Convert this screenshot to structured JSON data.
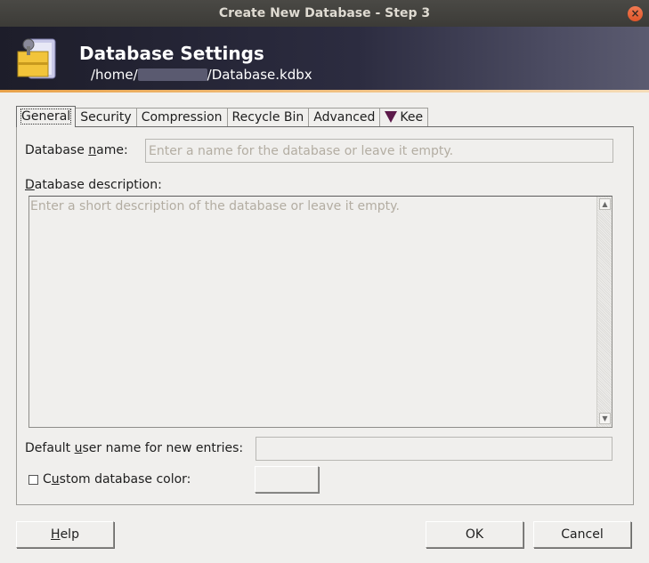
{
  "window": {
    "title": "Create New Database - Step 3",
    "close_glyph": "×"
  },
  "banner": {
    "title": "Database Settings",
    "path_prefix": "/home/",
    "path_suffix": "/Database.kdbx"
  },
  "tabs": [
    {
      "label": "General",
      "active": true
    },
    {
      "label": "Security"
    },
    {
      "label": "Compression"
    },
    {
      "label": "Recycle Bin"
    },
    {
      "label": "Advanced"
    },
    {
      "label": "Kee"
    }
  ],
  "general": {
    "db_name_label_pre": "Database ",
    "db_name_label_u": "n",
    "db_name_label_post": "ame:",
    "db_name_value": "",
    "db_name_placeholder": "Enter a name for the database or leave it empty.",
    "db_desc_label_u": "D",
    "db_desc_label_post": "atabase description:",
    "db_desc_value": "",
    "db_desc_placeholder": "Enter a short description of the database or leave it empty.",
    "scroll_up_glyph": "▲",
    "scroll_down_glyph": "▼",
    "user_label_pre": "Default ",
    "user_label_u": "u",
    "user_label_post": "ser name for new entries:",
    "user_value": "",
    "color_label_pre": "C",
    "color_label_u": "u",
    "color_label_post": "stom database color:",
    "color_checked": false
  },
  "buttons": {
    "help_u": "H",
    "help_post": "elp",
    "ok": "OK",
    "cancel": "Cancel"
  },
  "colors": {
    "banner_accent": "#e8a24a",
    "kee_icon": "#5c1a4a",
    "close_button": "#e0562a"
  }
}
